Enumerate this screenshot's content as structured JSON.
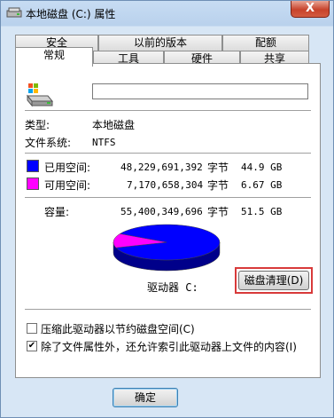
{
  "window": {
    "title": "本地磁盘 (C:) 属性",
    "close_label": "X"
  },
  "tabs_back": [
    {
      "label": "安全"
    },
    {
      "label": "以前的版本"
    },
    {
      "label": "配额"
    }
  ],
  "tabs_front": [
    {
      "label": "常规"
    },
    {
      "label": "工具"
    },
    {
      "label": "硬件"
    },
    {
      "label": "共享"
    }
  ],
  "general": {
    "volume_name_value": "",
    "type_label": "类型:",
    "type_value": "本地磁盘",
    "fs_label": "文件系统:",
    "fs_value": "NTFS",
    "used": {
      "label": "已用空间:",
      "bytes": "48,229,691,392",
      "unit": "字节",
      "size": "44.9 GB",
      "color": "#0000ff"
    },
    "free": {
      "label": "可用空间:",
      "bytes": "7,170,658,304",
      "unit": "字节",
      "size": "6.67 GB",
      "color": "#ff00ff"
    },
    "capacity": {
      "label": "容量:",
      "bytes": "55,400,349,696",
      "unit": "字节",
      "size": "51.5 GB"
    },
    "drive_label": "驱动器 C:",
    "cleanup_button": "磁盘清理(D)",
    "compress_label": "压缩此驱动器以节约磁盘空间(C)",
    "compress_checked": false,
    "index_label": "除了文件属性外，还允许索引此驱动器上文件的内容(I)",
    "index_checked": true,
    "used_fraction": 0.8706
  },
  "footer": {
    "ok_button": "确定"
  }
}
